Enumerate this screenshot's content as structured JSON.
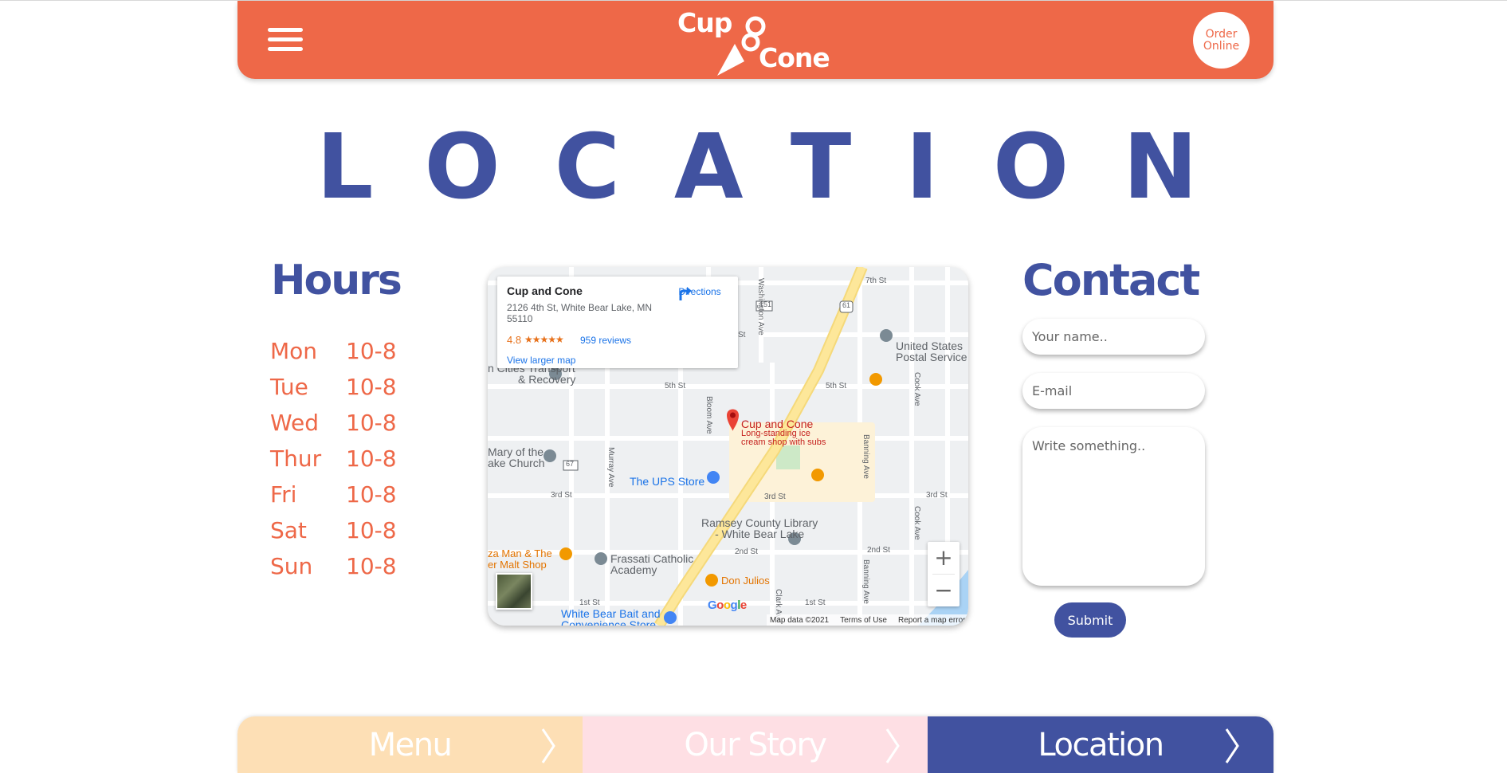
{
  "header": {
    "logo_top": "Cup",
    "logo_bottom": "Cone",
    "order_label": "Order Online",
    "brand_color": "#ee6848"
  },
  "page": {
    "title": "LOCATION",
    "title_color": "#4152a0"
  },
  "hours": {
    "title": "Hours",
    "rows": [
      {
        "day": "Mon",
        "time": "10-8"
      },
      {
        "day": "Tue",
        "time": "10-8"
      },
      {
        "day": "Wed",
        "time": "10-8"
      },
      {
        "day": "Thur",
        "time": "10-8"
      },
      {
        "day": "Fri",
        "time": "10-8"
      },
      {
        "day": "Sat",
        "time": "10-8"
      },
      {
        "day": "Sun",
        "time": "10-8"
      }
    ]
  },
  "map": {
    "place_name": "Cup and Cone",
    "address": "2126 4th St, White Bear Lake, MN 55110",
    "rating": "4.8",
    "stars": "★★★★★",
    "reviews": "959 reviews",
    "directions": "Directions",
    "larger_map": "View larger map",
    "pin_title": "Cup and Cone",
    "pin_line1": "Long-standing ice",
    "pin_line2": "cream shop with subs",
    "labels": {
      "usps1": "United States",
      "usps2": "Postal Service",
      "transport1": "n Cities Transport",
      "transport2": "& Recovery",
      "church1": "Mary of the",
      "church2": "ake Church",
      "ups": "The UPS Store",
      "library1": "Ramsey County Library",
      "library2": "- White Bear Lake",
      "pizza1": "za Man & The",
      "pizza2": "er Malt Shop",
      "frassati1": "Frassati Catholic",
      "frassati2": "Academy",
      "donjulios": "Don Julios",
      "bait1": "White Bear Bait and",
      "bait2": "Convenience Store",
      "st7": "7th St",
      "st5a": "5th St",
      "st5b": "5th St",
      "st3a": "3rd St",
      "st3b": "3rd St",
      "st3c": "3rd St",
      "st2a": "2nd St",
      "st2b": "2nd St",
      "st1a": "1st St",
      "st1b": "1st St",
      "washington": "Washington Ave",
      "bloom": "Bloom Ave",
      "murray": "Murray Ave",
      "banning1": "Banning Ave",
      "banning2": "Banning Ave",
      "cook1": "Cook Ave",
      "cook2": "Cook Ave",
      "clark": "Clark Ave",
      "r151": "151",
      "r61": "61",
      "r67": "67",
      "st_top": "St"
    },
    "footer": {
      "data": "Map data ©2021",
      "terms": "Terms of Use",
      "report": "Report a map error"
    },
    "zoom_in": "+",
    "zoom_out": "−"
  },
  "contact": {
    "title": "Contact",
    "name_placeholder": "Your name..",
    "email_placeholder": "E-mail",
    "message_placeholder": "Write something..",
    "submit_label": "Submit"
  },
  "bottom_nav": {
    "items": [
      {
        "label": "Menu",
        "color": "#fddfb5"
      },
      {
        "label": "Our Story",
        "color": "#fedfe4"
      },
      {
        "label": "Location",
        "color": "#4152a0"
      }
    ]
  }
}
